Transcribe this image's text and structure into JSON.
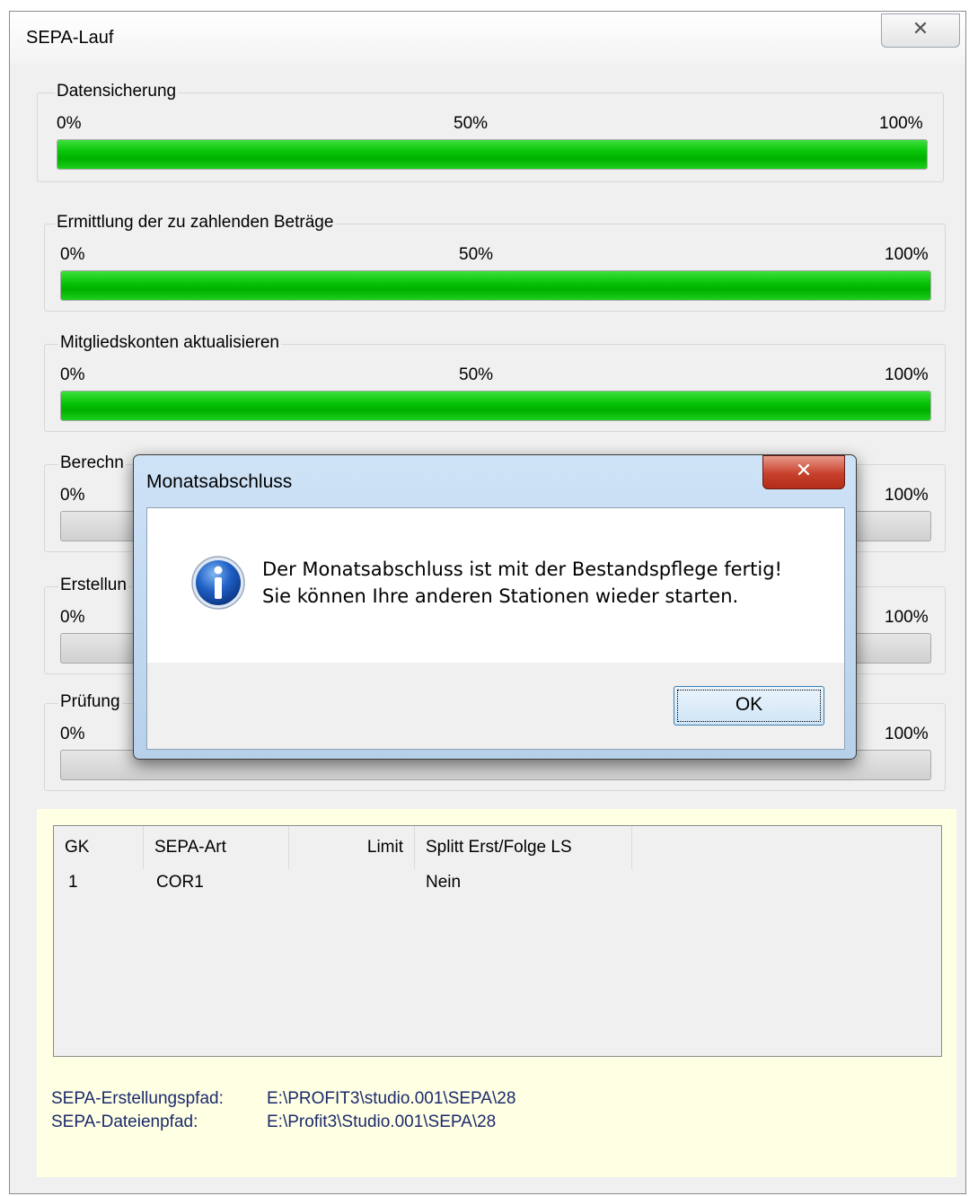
{
  "window": {
    "title": "SEPA-Lauf",
    "close_glyph": "✕"
  },
  "progress_groups": [
    {
      "label": "Datensicherung",
      "tick_min": "0%",
      "tick_mid": "50%",
      "tick_max": "100%",
      "progress_percent": 100
    },
    {
      "label": "Ermittlung der zu zahlenden Beträge",
      "tick_min": "0%",
      "tick_mid": "50%",
      "tick_max": "100%",
      "progress_percent": 100
    },
    {
      "label": "Mitgliedskonten aktualisieren",
      "tick_min": "0%",
      "tick_mid": "50%",
      "tick_max": "100%",
      "progress_percent": 100
    },
    {
      "label": "Berechn",
      "tick_min": "0%",
      "tick_max": "100%",
      "progress_percent": 0
    },
    {
      "label": "Erstellun",
      "tick_min": "0%",
      "tick_max": "100%",
      "progress_percent": 0
    },
    {
      "label": "Prüfung",
      "tick_min": "0%",
      "tick_max": "100%",
      "progress_percent": 0
    }
  ],
  "table": {
    "columns": [
      "GK",
      "SEPA-Art",
      "Limit",
      "Splitt Erst/Folge LS"
    ],
    "rows": [
      {
        "gk": "1",
        "sepa_art": "COR1",
        "limit": "",
        "splitt": "Nein"
      }
    ]
  },
  "paths": {
    "creation_label": "SEPA-Erstellungspfad:",
    "creation_value": "E:\\PROFIT3\\studio.001\\SEPA\\28",
    "file_label": "SEPA-Dateienpfad:",
    "file_value": "E:\\Profit3\\Studio.001\\SEPA\\28"
  },
  "dialog": {
    "title": "Monatsabschluss",
    "close_glyph": "✕",
    "message_line1": "Der Monatsabschluss ist mit der Bestandspflege fertig!",
    "message_line2": "Sie können Ihre anderen Stationen wieder starten.",
    "ok_label": "OK",
    "icon": "info-icon"
  }
}
